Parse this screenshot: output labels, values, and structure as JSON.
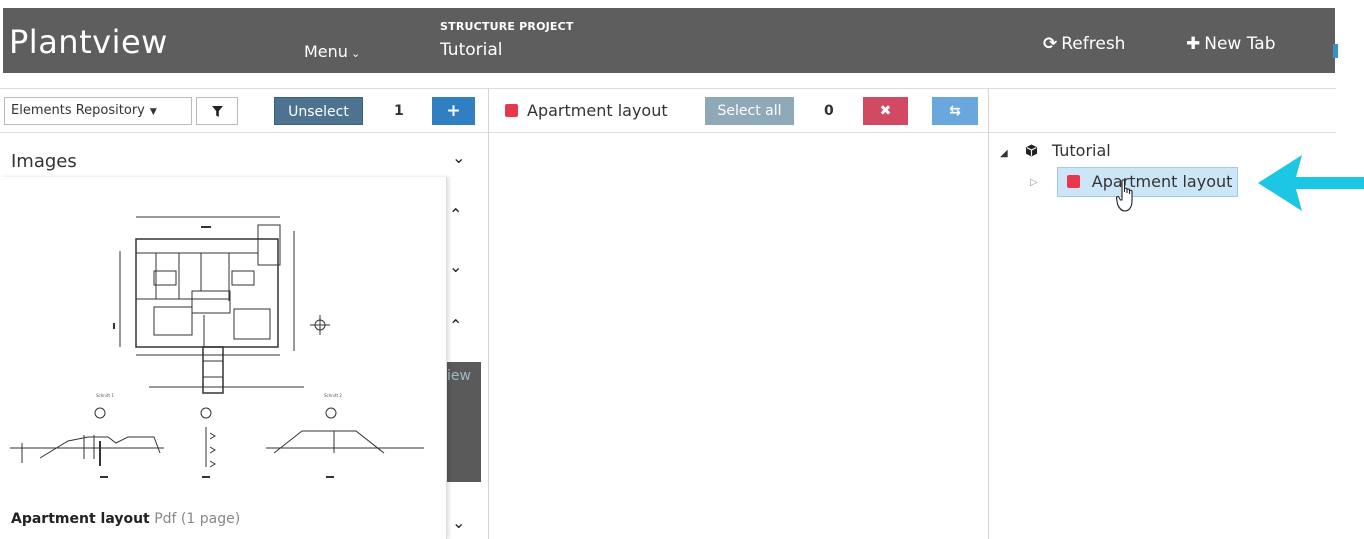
{
  "header": {
    "app_title": "Plantview",
    "menu_label": "Menu",
    "project_kicker": "STRUCTURE PROJECT",
    "project_name": "Tutorial",
    "refresh_label": "Refresh",
    "new_tab_label": "New Tab"
  },
  "toolbar": {
    "repository_select": "Elements Repository",
    "unselect_label": "Unselect",
    "left_count": "1",
    "selected_item": "Apartment layout",
    "select_all_label": "Select all",
    "right_count": "0"
  },
  "left_panel": {
    "heading": "Images",
    "card_title": "Apartment layout",
    "card_meta": "Pdf (1 page)",
    "partial_text": "iew"
  },
  "tree": {
    "root_label": "Tutorial",
    "child_label": "Apartment layout"
  },
  "icons": {
    "refresh": "refresh-icon",
    "new_tab": "plus-icon",
    "filter": "filter-icon",
    "add": "plus-icon",
    "remove": "close-icon",
    "swap": "swap-icon",
    "tree_root": "cube-icon"
  },
  "colors": {
    "header_bg": "#5e5e5e",
    "unselect_bg": "#4e7390",
    "add_bg": "#2f7fc1",
    "select_all_bg": "#8fa9b9",
    "remove_bg": "#d04a63",
    "swap_bg": "#6aa7dc",
    "tag_red": "#e8394c",
    "selection_bg": "#cde6f7",
    "arrow_cyan": "#1cc7e6"
  }
}
